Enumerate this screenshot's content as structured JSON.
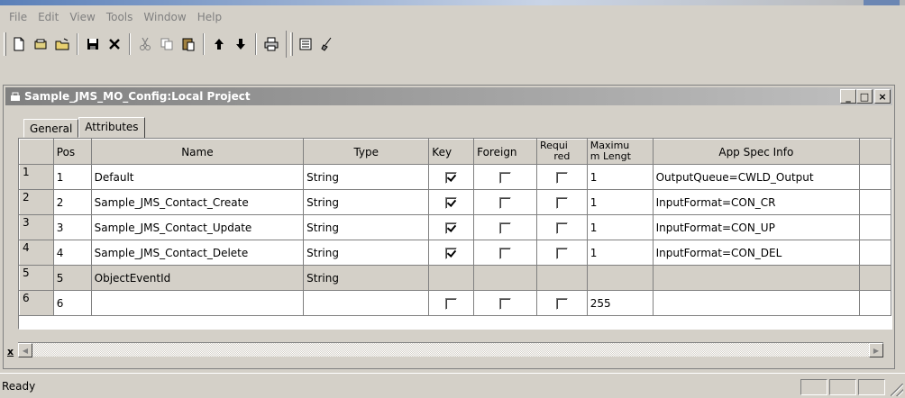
{
  "menu": [
    "File",
    "Edit",
    "View",
    "Tools",
    "Window",
    "Help"
  ],
  "toolbar_icons": [
    "new-document-icon",
    "open-icon",
    "open-folder-icon",
    "save-icon",
    "delete-icon",
    "cut-icon",
    "copy-icon",
    "paste-icon",
    "move-up-icon",
    "move-down-icon",
    "print-icon",
    "properties-icon",
    "clean-icon"
  ],
  "window": {
    "title": "Sample_JMS_MO_Config:Local Project",
    "min_label": "_",
    "max_label": "□",
    "close_label": "×"
  },
  "tabs": [
    {
      "label": "General",
      "active": false
    },
    {
      "label": "Attributes",
      "active": true
    }
  ],
  "table": {
    "headers": {
      "pos": "Pos",
      "name": "Name",
      "type": "Type",
      "key": "Key",
      "foreign": "Foreign",
      "required_1": "Requi",
      "required_2": "red",
      "maxlen_1": "Maximu",
      "maxlen_2": "m Lengt",
      "appspec": "App Spec Info"
    },
    "rows": [
      {
        "num": "1",
        "pos": "1",
        "name": "Default",
        "type": "String",
        "key": true,
        "foreign": false,
        "required": false,
        "maxlen": "1",
        "appspec": "OutputQueue=CWLD_Output"
      },
      {
        "num": "2",
        "pos": "2",
        "name": "Sample_JMS_Contact_Create",
        "type": "String",
        "key": true,
        "foreign": false,
        "required": false,
        "maxlen": "1",
        "appspec": "InputFormat=CON_CR"
      },
      {
        "num": "3",
        "pos": "3",
        "name": "Sample_JMS_Contact_Update",
        "type": "String",
        "key": true,
        "foreign": false,
        "required": false,
        "maxlen": "1",
        "appspec": "InputFormat=CON_UP"
      },
      {
        "num": "4",
        "pos": "4",
        "name": "Sample_JMS_Contact_Delete",
        "type": "String",
        "key": true,
        "foreign": false,
        "required": false,
        "maxlen": "1",
        "appspec": "InputFormat=CON_DEL"
      },
      {
        "num": "5",
        "pos": "5",
        "name": "ObjectEventId",
        "type": "String",
        "key": null,
        "foreign": null,
        "required": null,
        "maxlen": "",
        "appspec": ""
      },
      {
        "num": "6",
        "pos": "6",
        "name": "",
        "type": "",
        "key": false,
        "foreign": false,
        "required": false,
        "maxlen": "255",
        "appspec": ""
      }
    ]
  },
  "status": {
    "text": "Ready"
  }
}
